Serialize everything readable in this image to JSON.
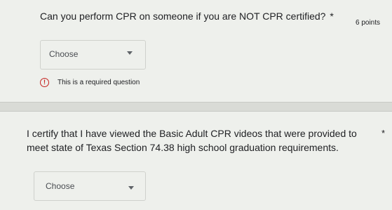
{
  "question1": {
    "title": "Can you perform CPR on someone if you are NOT CPR certified?",
    "required_mark": "*",
    "points": "6 points",
    "dropdown": {
      "selected": "Choose"
    },
    "error": {
      "icon": "!",
      "message": "This is a required question"
    }
  },
  "question2": {
    "title": "I certify that I have viewed the Basic Adult CPR videos that were provided to meet state of Texas Section 74.38 high school graduation requirements.",
    "required_mark": "*",
    "dropdown": {
      "selected": "Choose"
    }
  },
  "colors": {
    "background": "#d9dbd6",
    "card": "#eef0ec",
    "error": "#c5221f",
    "text": "#202124"
  }
}
